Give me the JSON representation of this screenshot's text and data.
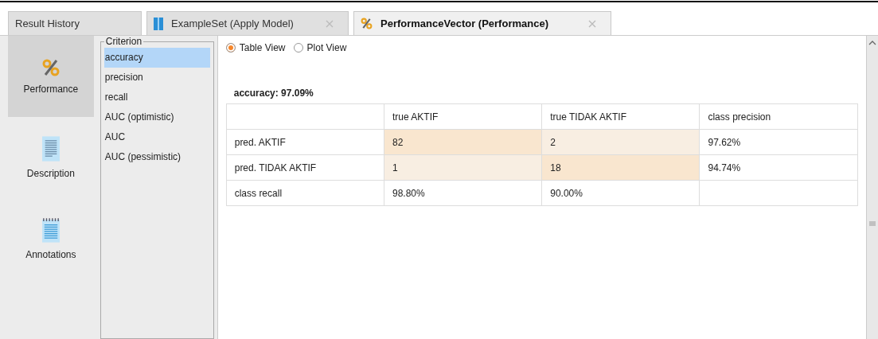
{
  "tabs": [
    {
      "label": "Result History",
      "closable": false,
      "selected": false
    },
    {
      "label": "ExampleSet (Apply Model)",
      "closable": true,
      "selected": false
    },
    {
      "label": "PerformanceVector (Performance)",
      "closable": true,
      "selected": true
    }
  ],
  "views": [
    {
      "label": "Performance",
      "selected": true
    },
    {
      "label": "Description",
      "selected": false
    },
    {
      "label": "Annotations",
      "selected": false
    }
  ],
  "criterion": {
    "title": "Criterion",
    "items": [
      {
        "label": "accuracy",
        "selected": true
      },
      {
        "label": "precision",
        "selected": false
      },
      {
        "label": "recall",
        "selected": false
      },
      {
        "label": "AUC (optimistic)",
        "selected": false
      },
      {
        "label": "AUC",
        "selected": false
      },
      {
        "label": "AUC (pessimistic)",
        "selected": false
      }
    ]
  },
  "view_mode": [
    {
      "label": "Table View",
      "selected": true
    },
    {
      "label": "Plot View",
      "selected": false
    }
  ],
  "result_title": "accuracy: 97.09%",
  "table": {
    "columns": [
      "true AKTIF",
      "true TIDAK AKTIF",
      "class precision"
    ],
    "rows": [
      {
        "label": "pred. AKTIF",
        "cells": [
          {
            "text": "82",
            "kind": "hit"
          },
          {
            "text": "2",
            "kind": "miss"
          },
          {
            "text": "97.62%",
            "kind": "plain"
          }
        ]
      },
      {
        "label": "pred. TIDAK AKTIF",
        "cells": [
          {
            "text": "1",
            "kind": "miss"
          },
          {
            "text": "18",
            "kind": "hit"
          },
          {
            "text": "94.74%",
            "kind": "plain"
          }
        ]
      },
      {
        "label": "class recall",
        "cells": [
          {
            "text": "98.80%",
            "kind": "plain"
          },
          {
            "text": "90.00%",
            "kind": "plain"
          }
        ]
      }
    ]
  }
}
